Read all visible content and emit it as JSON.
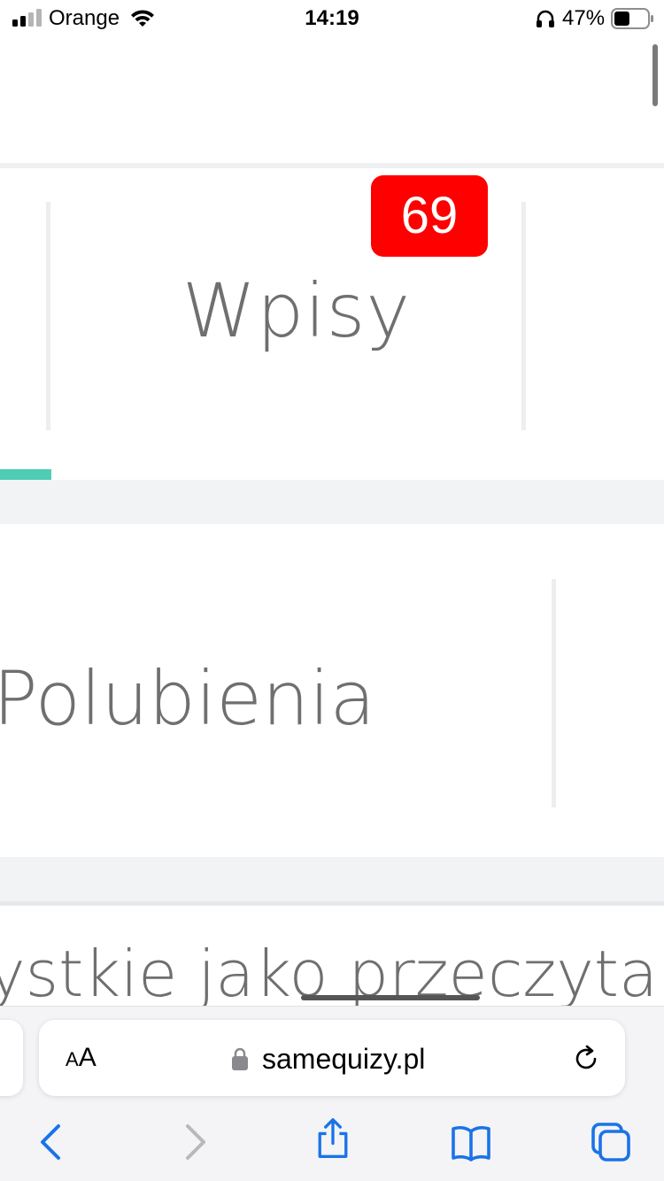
{
  "status_bar": {
    "carrier": "Orange",
    "time": "14:19",
    "battery_percent": "47%",
    "signal_bars": 2,
    "battery_level": 0.47
  },
  "tabs": [
    {
      "label": "Wpisy",
      "badge": "69",
      "active": true
    },
    {
      "label": "Polubienia"
    }
  ],
  "mark_all_read_text": "ystkie jako przeczytane",
  "safari": {
    "text_size_label_small": "A",
    "text_size_label_big": "A",
    "url": "samequizy.pl",
    "icons": [
      "lock-icon",
      "reload-icon",
      "back-icon",
      "forward-icon",
      "share-icon",
      "bookmarks-icon",
      "tabs-icon"
    ]
  },
  "colors": {
    "badge": "#ff0000",
    "active_indicator": "#4ecdb4",
    "ios_blue": "#1a73e8",
    "label_gray": "#6f6f6f"
  }
}
